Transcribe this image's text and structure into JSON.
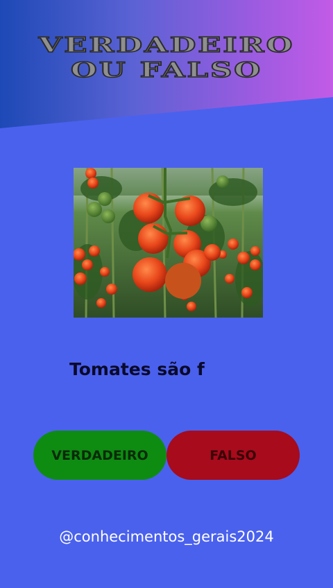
{
  "header": {
    "title_line1": "VERDADEIRO",
    "title_line2": "OU FALSO"
  },
  "question": {
    "text": "Tomates são f"
  },
  "buttons": {
    "true_label": "VERDADEIRO",
    "false_label": "FALSO"
  },
  "footer": {
    "handle": "@conhecimentos_gerais2024"
  },
  "colors": {
    "background": "#4a61ee",
    "true_button": "#0e8c12",
    "false_button": "#a70b1c",
    "header_gradient_start": "#1d49b6",
    "header_gradient_end": "#c25be6"
  }
}
